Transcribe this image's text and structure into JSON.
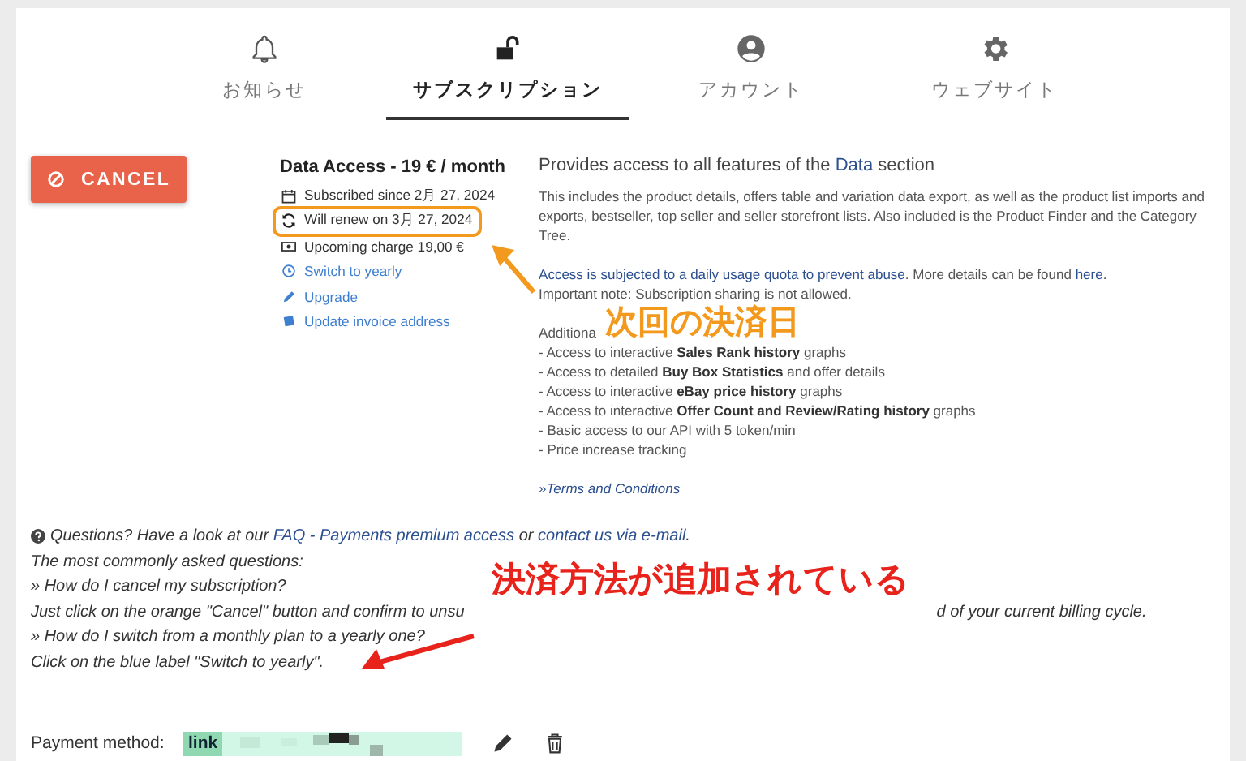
{
  "tabs": [
    {
      "label": "お知らせ",
      "selected": false
    },
    {
      "label": "サブスクリプション",
      "selected": true
    },
    {
      "label": "アカウント",
      "selected": false
    },
    {
      "label": "ウェブサイト",
      "selected": false
    }
  ],
  "cancel_button": {
    "label": "CANCEL"
  },
  "plan": {
    "title": "Data Access - 19 € / month",
    "details": [
      {
        "kind": "info",
        "text": "Subscribed since 2月 27, 2024"
      },
      {
        "kind": "info",
        "text": "Will renew on 3月 27, 2024",
        "highlighted": true
      },
      {
        "kind": "info",
        "text": "Upcoming charge 19,00 €"
      },
      {
        "kind": "link",
        "text": "Switch to yearly"
      },
      {
        "kind": "link",
        "text": "Upgrade"
      },
      {
        "kind": "link",
        "text": "Update invoice address"
      }
    ]
  },
  "description": {
    "title": [
      {
        "text": "Provides access to all features of the ",
        "link": false
      },
      {
        "text": "Data",
        "link": true
      },
      {
        "text": " section",
        "link": false
      }
    ],
    "intro": "This includes the product details, offers table and variation data export, as well as the product list imports and exports, bestseller, top seller and seller storefront lists. Also included is the Product Finder and the Category Tree.",
    "quota": [
      {
        "text": "Access is subjected to a daily usage quota to prevent abuse",
        "link": true
      },
      {
        "text": ". More details can be found ",
        "link": false
      },
      {
        "text": "here",
        "link": true
      },
      {
        "text": ".",
        "link": false
      }
    ],
    "note": "Important note: Subscription sharing is not allowed.",
    "additional": "Additiona",
    "features": [
      "- Access to interactive **Sales Rank history** graphs",
      "- Access to detailed **Buy Box Statistics** and offer details",
      "- Access to interactive **eBay price history** graphs",
      "- Access to interactive **Offer Count and Review/Rating history** graphs",
      "- Basic access to our API with 5 token/min",
      "- Price increase tracking"
    ],
    "terms_link": "»Terms and Conditions"
  },
  "questions": {
    "intro": [
      {
        "text": "Questions? Have a look at our ",
        "link": false
      },
      {
        "text": "FAQ - Payments premium access",
        "link": true
      },
      {
        "text": " or ",
        "link": false
      },
      {
        "text": "contact us via e-mail",
        "link": true
      },
      {
        "text": ".",
        "link": false
      }
    ],
    "lines": [
      [
        "The most commonly asked questions:"
      ],
      [
        "» How do I cancel my subscription?"
      ],
      [
        "Just click on the orange \"Cancel\" button and confirm to unsu",
        "d of your current billing cycle."
      ],
      [
        "» How do I switch from a monthly plan to a yearly one?"
      ],
      [
        "Click on the blue label \"Switch to yearly\"."
      ]
    ]
  },
  "payment": {
    "label": "Payment method:",
    "method": "link"
  },
  "annotations": [
    {
      "text": "次回の決済日",
      "color": "#f39a1e"
    },
    {
      "text": "決済方法が追加されている",
      "color": "#e8231c"
    }
  ]
}
